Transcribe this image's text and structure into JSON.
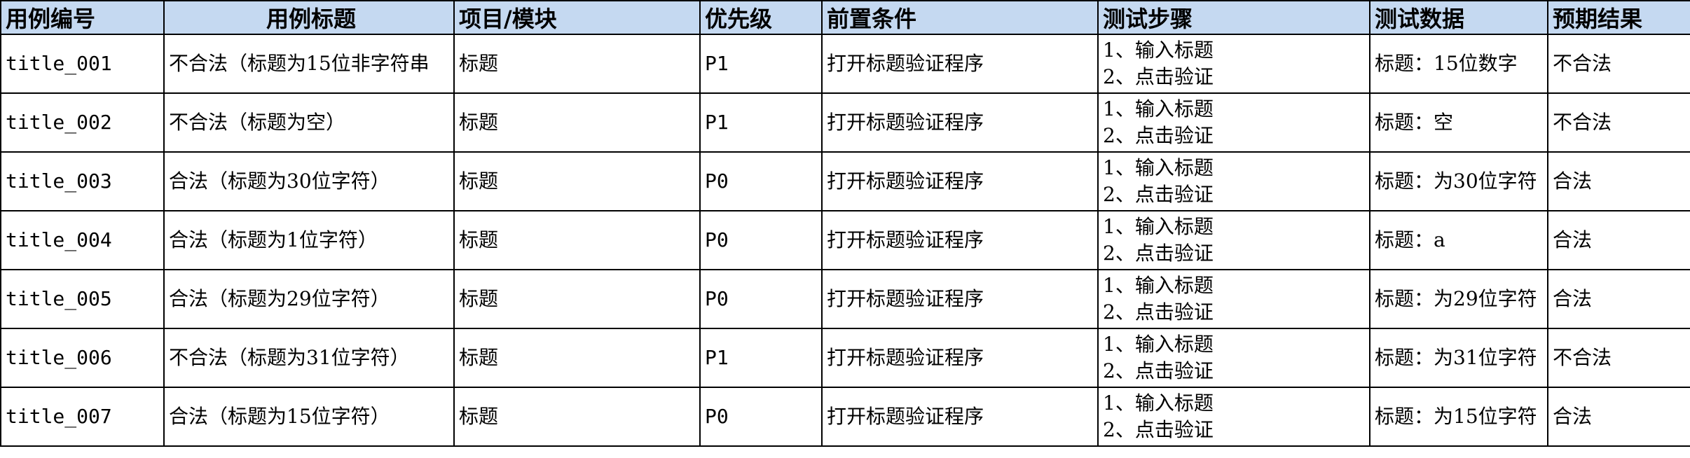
{
  "table": {
    "headers": [
      "用例编号",
      "用例标题",
      "项目/模块",
      "优先级",
      "前置条件",
      "测试步骤",
      "测试数据",
      "预期结果"
    ],
    "rows": [
      {
        "id": "title_001",
        "title": "不合法（标题为15位非字符串",
        "module": "标题",
        "priority": "P1",
        "precondition": "打开标题验证程序",
        "step1": "1、输入标题",
        "step2": "2、点击验证",
        "data": "标题：15位数字",
        "expected": "不合法"
      },
      {
        "id": "title_002",
        "title": "不合法（标题为空）",
        "module": "标题",
        "priority": "P1",
        "precondition": "打开标题验证程序",
        "step1": "1、输入标题",
        "step2": "2、点击验证",
        "data": "标题：空",
        "expected": "不合法"
      },
      {
        "id": "title_003",
        "title": "合法（标题为30位字符）",
        "module": "标题",
        "priority": "P0",
        "precondition": "打开标题验证程序",
        "step1": "1、输入标题",
        "step2": "2、点击验证",
        "data": "标题：为30位字符",
        "expected": "合法"
      },
      {
        "id": "title_004",
        "title": "合法（标题为1位字符）",
        "module": "标题",
        "priority": "P0",
        "precondition": "打开标题验证程序",
        "step1": "1、输入标题",
        "step2": "2、点击验证",
        "data": "标题：a",
        "expected": "合法"
      },
      {
        "id": "title_005",
        "title": "合法（标题为29位字符）",
        "module": "标题",
        "priority": "P0",
        "precondition": "打开标题验证程序",
        "step1": "1、输入标题",
        "step2": "2、点击验证",
        "data": "标题：为29位字符",
        "expected": "合法"
      },
      {
        "id": "title_006",
        "title": "不合法（标题为31位字符）",
        "module": "标题",
        "priority": "P1",
        "precondition": "打开标题验证程序",
        "step1": "1、输入标题",
        "step2": "2、点击验证",
        "data": "标题：为31位字符",
        "expected": "不合法"
      },
      {
        "id": "title_007",
        "title": "合法（标题为15位字符）",
        "module": "标题",
        "priority": "P0",
        "precondition": "打开标题验证程序",
        "step1": "1、输入标题",
        "step2": "2、点击验证",
        "data": "标题：为15位字符",
        "expected": "合法"
      }
    ]
  },
  "colors": {
    "header_bg": "#c5d9f1",
    "grid": "#000000"
  }
}
